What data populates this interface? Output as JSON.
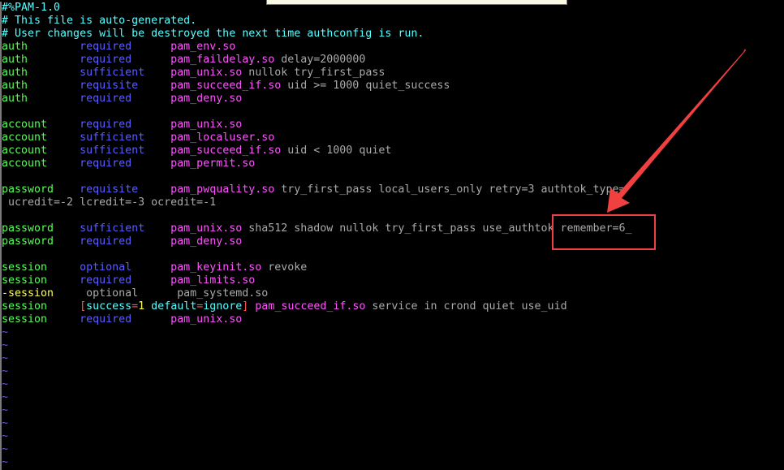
{
  "editor": {
    "lines": [
      [
        {
          "t": "#%PAM-1.0",
          "c": "cyan"
        }
      ],
      [
        {
          "t": "# This file is auto-generated.",
          "c": "cyan"
        }
      ],
      [
        {
          "t": "# User changes will be destroyed the next time authconfig is run.",
          "c": "cyan"
        }
      ],
      [
        {
          "t": "auth        ",
          "c": "green"
        },
        {
          "t": "required      ",
          "c": "blue"
        },
        {
          "t": "pam_env.so",
          "c": "mag"
        }
      ],
      [
        {
          "t": "auth        ",
          "c": "green"
        },
        {
          "t": "required      ",
          "c": "blue"
        },
        {
          "t": "pam_faildelay.so",
          "c": "mag"
        },
        {
          "t": " delay=2000000",
          "c": "gray"
        }
      ],
      [
        {
          "t": "auth        ",
          "c": "green"
        },
        {
          "t": "sufficient    ",
          "c": "blue"
        },
        {
          "t": "pam_unix.so",
          "c": "mag"
        },
        {
          "t": " nullok try_first_pass",
          "c": "gray"
        }
      ],
      [
        {
          "t": "auth        ",
          "c": "green"
        },
        {
          "t": "requisite     ",
          "c": "blue"
        },
        {
          "t": "pam_succeed_if.so",
          "c": "mag"
        },
        {
          "t": " uid >= 1000 quiet_success",
          "c": "gray"
        }
      ],
      [
        {
          "t": "auth        ",
          "c": "green"
        },
        {
          "t": "required      ",
          "c": "blue"
        },
        {
          "t": "pam_deny.so",
          "c": "mag"
        }
      ],
      [],
      [
        {
          "t": "account     ",
          "c": "green"
        },
        {
          "t": "required      ",
          "c": "blue"
        },
        {
          "t": "pam_unix.so",
          "c": "mag"
        }
      ],
      [
        {
          "t": "account     ",
          "c": "green"
        },
        {
          "t": "sufficient    ",
          "c": "blue"
        },
        {
          "t": "pam_localuser.so",
          "c": "mag"
        }
      ],
      [
        {
          "t": "account     ",
          "c": "green"
        },
        {
          "t": "sufficient    ",
          "c": "blue"
        },
        {
          "t": "pam_succeed_if.so",
          "c": "mag"
        },
        {
          "t": " uid < 1000 quiet",
          "c": "gray"
        }
      ],
      [
        {
          "t": "account     ",
          "c": "green"
        },
        {
          "t": "required      ",
          "c": "blue"
        },
        {
          "t": "pam_permit.so",
          "c": "mag"
        }
      ],
      [],
      [
        {
          "t": "password    ",
          "c": "green"
        },
        {
          "t": "requisite     ",
          "c": "blue"
        },
        {
          "t": "pam_pwquality.so",
          "c": "mag"
        },
        {
          "t": " try_first_pass local_users_only retry=3 authtok_type=",
          "c": "gray"
        }
      ],
      [
        {
          "t": " ucredit=-2 lcredit=-3 ocredit=-1",
          "c": "gray"
        }
      ],
      [],
      [
        {
          "t": "password    ",
          "c": "green"
        },
        {
          "t": "sufficient    ",
          "c": "blue"
        },
        {
          "t": "pam_unix.so",
          "c": "mag"
        },
        {
          "t": " sha512 shadow nullok try_first_pass use_authtok remember=6_",
          "c": "gray"
        }
      ],
      [
        {
          "t": "password    ",
          "c": "green"
        },
        {
          "t": "required      ",
          "c": "blue"
        },
        {
          "t": "pam_deny.so",
          "c": "mag"
        }
      ],
      [],
      [
        {
          "t": "session     ",
          "c": "green"
        },
        {
          "t": "optional      ",
          "c": "blue"
        },
        {
          "t": "pam_keyinit.so",
          "c": "mag"
        },
        {
          "t": " revoke",
          "c": "gray"
        }
      ],
      [
        {
          "t": "session     ",
          "c": "green"
        },
        {
          "t": "required      ",
          "c": "blue"
        },
        {
          "t": "pam_limits.so",
          "c": "mag"
        }
      ],
      [
        {
          "t": "-session     ",
          "c": "yel"
        },
        {
          "t": "optional      pam_systemd.so",
          "c": "gray"
        }
      ],
      [
        {
          "t": "session     ",
          "c": "green"
        },
        {
          "t": "[",
          "c": "red"
        },
        {
          "t": "success",
          "c": "cyan"
        },
        {
          "t": "=",
          "c": "red"
        },
        {
          "t": "1",
          "c": "yel"
        },
        {
          "t": " default",
          "c": "cyan"
        },
        {
          "t": "=",
          "c": "red"
        },
        {
          "t": "ignore",
          "c": "cyan"
        },
        {
          "t": "]",
          "c": "red"
        },
        {
          "t": " pam_succeed_if.so",
          "c": "mag"
        },
        {
          "t": " service in crond quiet use_uid",
          "c": "gray"
        }
      ],
      [
        {
          "t": "session     ",
          "c": "green"
        },
        {
          "t": "required      ",
          "c": "blue"
        },
        {
          "t": "pam_unix.so",
          "c": "mag"
        }
      ]
    ],
    "empty_line_marker": "~",
    "empty_line_count": 11
  },
  "annotation": {
    "color": "#f04040",
    "highlighted_text": "remember=6"
  }
}
